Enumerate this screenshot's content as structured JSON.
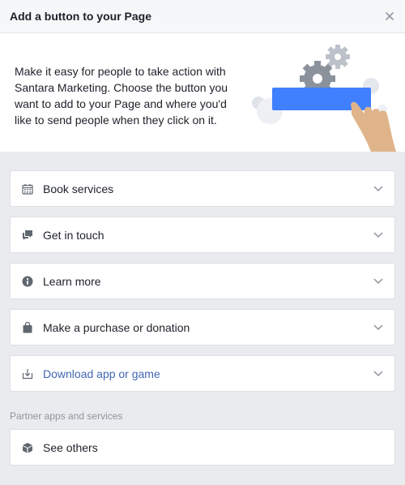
{
  "dialog": {
    "title": "Add a button to your Page",
    "close_icon": "close-icon"
  },
  "intro": {
    "text": "Make it easy for people to take action with Santara Marketing. Choose the button you want to add to your Page and where you'd like to send people when they click on it."
  },
  "options": [
    {
      "label": "Book services",
      "icon": "calendar-icon"
    },
    {
      "label": "Get in touch",
      "icon": "chat-bubbles-icon"
    },
    {
      "label": "Learn more",
      "icon": "info-icon"
    },
    {
      "label": "Make a purchase or donation",
      "icon": "shopping-bag-icon"
    },
    {
      "label": "Download app or game",
      "icon": "download-icon"
    }
  ],
  "partner": {
    "section_label": "Partner apps and services",
    "items": [
      {
        "label": "See others",
        "icon": "cube-icon"
      }
    ]
  },
  "colors": {
    "link_blue": "#4267b2",
    "accent_blue": "#4080ff",
    "hand": "#e0b48a",
    "icon_gray": "#606770"
  }
}
